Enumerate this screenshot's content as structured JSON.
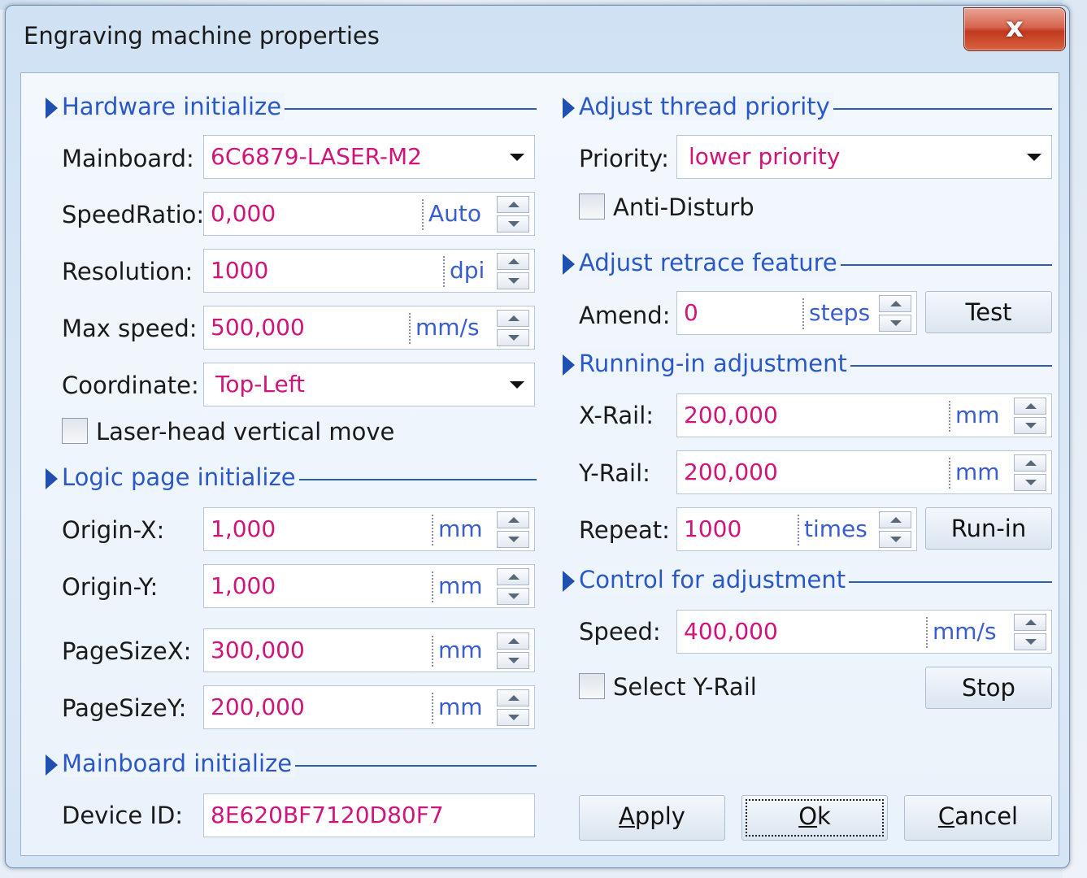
{
  "window": {
    "title": "Engraving machine properties",
    "close_glyph": "x"
  },
  "hardware": {
    "title": "Hardware initialize",
    "mainboard": {
      "label": "Mainboard:",
      "value": "6C6879-LASER-M2"
    },
    "speedratio": {
      "label": "SpeedRatio:",
      "value": "0,000",
      "unit": "Auto"
    },
    "resolution": {
      "label": "Resolution:",
      "value": "1000",
      "unit": "dpi"
    },
    "maxspeed": {
      "label": "Max speed:",
      "value": "500,000",
      "unit": "mm/s"
    },
    "coordinate": {
      "label": "Coordinate:",
      "value": "Top-Left"
    },
    "laser_vertical": {
      "label": "Laser-head vertical move",
      "checked": false
    }
  },
  "logic": {
    "title": "Logic page initialize",
    "origin_x": {
      "label": "Origin-X:",
      "value": "1,000",
      "unit": "mm"
    },
    "origin_y": {
      "label": "Origin-Y:",
      "value": "1,000",
      "unit": "mm"
    },
    "pagesize_x": {
      "label": "PageSizeX:",
      "value": "300,000",
      "unit": "mm"
    },
    "pagesize_y": {
      "label": "PageSizeY:",
      "value": "200,000",
      "unit": "mm"
    }
  },
  "mainboard_init": {
    "title": "Mainboard initialize",
    "device_id": {
      "label": "Device ID:",
      "value": "8E620BF7120D80F7"
    }
  },
  "thread": {
    "title": "Adjust thread priority",
    "priority": {
      "label": "Priority:",
      "value": "lower priority"
    },
    "anti_disturb": {
      "label": "Anti-Disturb",
      "checked": false
    }
  },
  "retrace": {
    "title": "Adjust retrace feature",
    "amend": {
      "label": "Amend:",
      "value": "0",
      "unit": "steps"
    },
    "test_label": "Test"
  },
  "running": {
    "title": "Running-in adjustment",
    "x_rail": {
      "label": "X-Rail:",
      "value": "200,000",
      "unit": "mm"
    },
    "y_rail": {
      "label": "Y-Rail:",
      "value": "200,000",
      "unit": "mm"
    },
    "repeat": {
      "label": "Repeat:",
      "value": "1000",
      "unit": "times"
    },
    "runin_label": "Run-in"
  },
  "control": {
    "title": "Control for adjustment",
    "speed": {
      "label": "Speed:",
      "value": "400,000",
      "unit": "mm/s"
    },
    "select_yrail": {
      "label": "Select Y-Rail",
      "checked": false
    },
    "stop_label": "Stop"
  },
  "buttons": {
    "apply": {
      "first": "A",
      "rest": "pply"
    },
    "ok": {
      "first": "O",
      "rest": "k"
    },
    "cancel": {
      "first": "C",
      "rest": "ancel"
    }
  },
  "colors": {
    "value_text": "#d0157a",
    "section_title": "#2a58c8",
    "unit_text": "#3a5ecf"
  }
}
